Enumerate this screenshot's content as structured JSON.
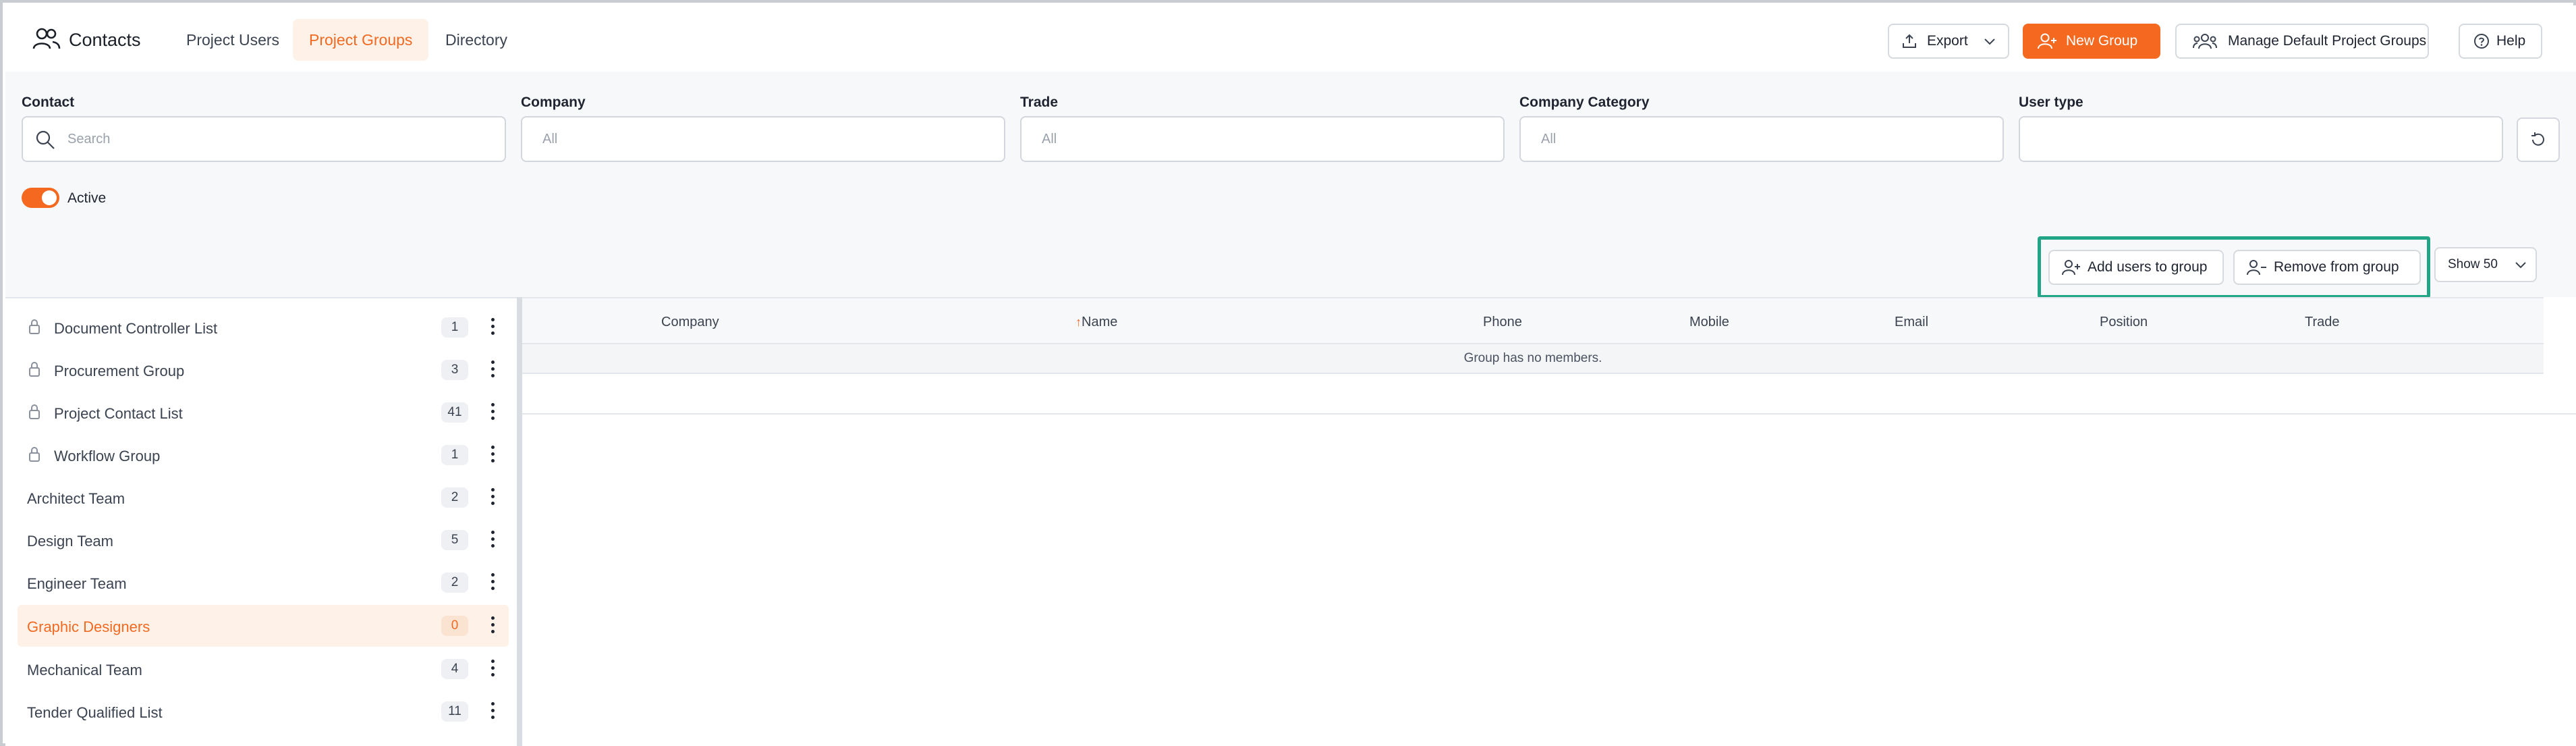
{
  "header": {
    "title": "Contacts",
    "tabs": [
      {
        "label": "Project Users",
        "active": false
      },
      {
        "label": "Project Groups",
        "active": true
      },
      {
        "label": "Directory",
        "active": false
      }
    ],
    "export_label": "Export",
    "new_group_label": "New Group",
    "manage_label": "Manage Default Project Groups",
    "help_label": "Help"
  },
  "filters": {
    "contact": {
      "label": "Contact",
      "placeholder": "Search"
    },
    "company": {
      "label": "Company",
      "value": "All"
    },
    "trade": {
      "label": "Trade",
      "value": "All"
    },
    "company_category": {
      "label": "Company Category",
      "value": "All"
    },
    "user_type": {
      "label": "User type",
      "value": ""
    },
    "active_label": "Active",
    "active_on": true
  },
  "toolbar": {
    "add_label": "Add users to group",
    "remove_label": "Remove from group",
    "show_label": "Show 50"
  },
  "groups": [
    {
      "name": "Document Controller List",
      "count": "1",
      "locked": true
    },
    {
      "name": "Procurement Group",
      "count": "3",
      "locked": true
    },
    {
      "name": "Project Contact List",
      "count": "41",
      "locked": true
    },
    {
      "name": "Workflow Group",
      "count": "1",
      "locked": true
    },
    {
      "name": "Architect Team",
      "count": "2",
      "locked": false
    },
    {
      "name": "Design Team",
      "count": "5",
      "locked": false
    },
    {
      "name": "Engineer Team",
      "count": "2",
      "locked": false
    },
    {
      "name": "Graphic Designers",
      "count": "0",
      "locked": false,
      "selected": true
    },
    {
      "name": "Mechanical Team",
      "count": "4",
      "locked": false
    },
    {
      "name": "Tender Qualified List",
      "count": "11",
      "locked": false
    }
  ],
  "table": {
    "columns": [
      "Company",
      "Name",
      "Phone",
      "Mobile",
      "Email",
      "Position",
      "Trade"
    ],
    "sort_indicator": "↑",
    "empty_message": "Group has no members."
  },
  "colors": {
    "accent": "#f4691f",
    "highlight": "#22a587"
  }
}
